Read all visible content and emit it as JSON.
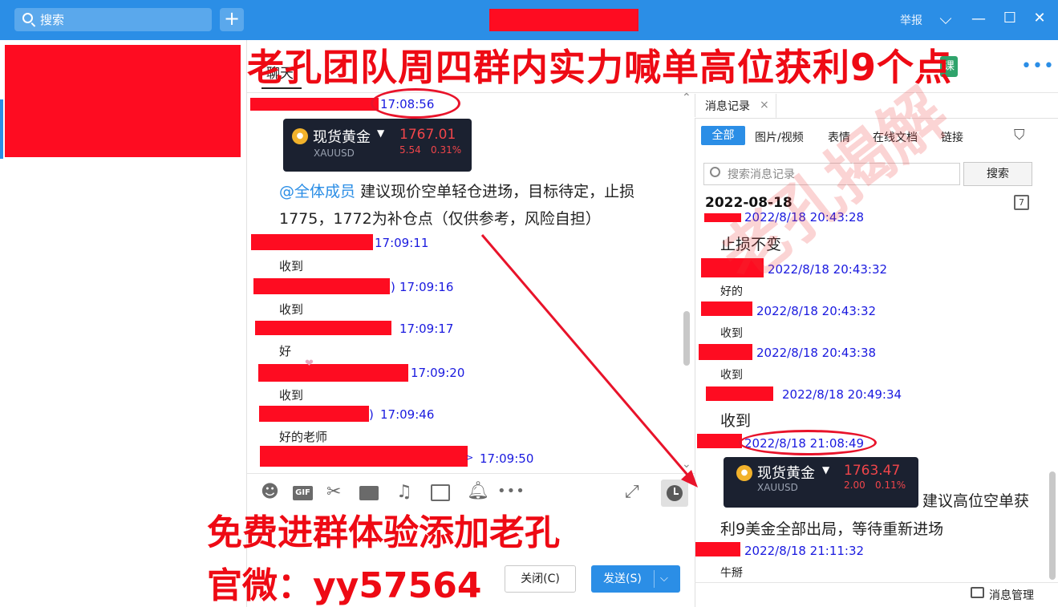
{
  "title_bar": {
    "search_placeholder": "搜索",
    "add_label": "+",
    "report_label": "举报",
    "chevron": "⌵",
    "minimize": "—",
    "maximize": "☐",
    "close": "✕"
  },
  "overlay": {
    "headline": "老孔团队周四群内实力喊单高位获利9个点",
    "promo_line1": "免费进群体验添加老孔",
    "promo_line2": "官微：yy57564",
    "watermark": "老孔揭解"
  },
  "chat": {
    "tab_label": "聊天",
    "messages": [
      {
        "time": "17:08:56"
      },
      {
        "time": "17:09:11",
        "text": "收到"
      },
      {
        "time": "17:09:16",
        "text": "收到"
      },
      {
        "time": "17:09:17",
        "text": "好"
      },
      {
        "time": "17:09:20",
        "text": "收到"
      },
      {
        "time": "17:09:46",
        "text": "好的老师"
      },
      {
        "time": "17:09:50"
      }
    ],
    "card": {
      "name": "现货黄金",
      "code": "XAUUSD",
      "price": "1767.01",
      "change": "5.54",
      "change_pct": "0.31%"
    },
    "mention": "@全体成员",
    "big_message_line1": "建议现价空单轻仓进场，目标待定，止损",
    "big_message_line2": "1775，1772为补仓点（仅供参考，风险自担）",
    "close_button": "关闭(C)",
    "send_button": "发送(S)"
  },
  "history": {
    "title": "消息记录",
    "filters": [
      "全部",
      "图片/视频",
      "表情",
      "在线文档",
      "链接"
    ],
    "search_placeholder": "搜索消息记录",
    "search_button": "搜索",
    "date_header": "2022-08-18",
    "entries": [
      {
        "time": "2022/8/18 20:43:28",
        "text": "止损不变"
      },
      {
        "time": "2022/8/18 20:43:32",
        "text": "好的"
      },
      {
        "time": "2022/8/18 20:43:32",
        "text": "收到"
      },
      {
        "time": "2022/8/18 20:43:38",
        "text": "收到"
      },
      {
        "time": "2022/8/18 20:49:34",
        "text": "收到"
      },
      {
        "time": "2022/8/18 21:08:49"
      },
      {
        "time": "2022/8/18 21:11:32",
        "text": "牛掰"
      }
    ],
    "card": {
      "name": "现货黄金",
      "code": "XAUUSD",
      "price": "1763.47",
      "change": "2.00",
      "change_pct": "0.11%"
    },
    "card_message_line1": "建议高位空单获",
    "card_message_line2": "利9美金全部出局，等待重新进场",
    "manage_label": "消息管理"
  },
  "colors": {
    "brand_blue": "#2b8ee6",
    "redaction": "#fe0c21",
    "timestamp_blue": "#1a1adf",
    "overlay_red": "#ee0a14"
  }
}
